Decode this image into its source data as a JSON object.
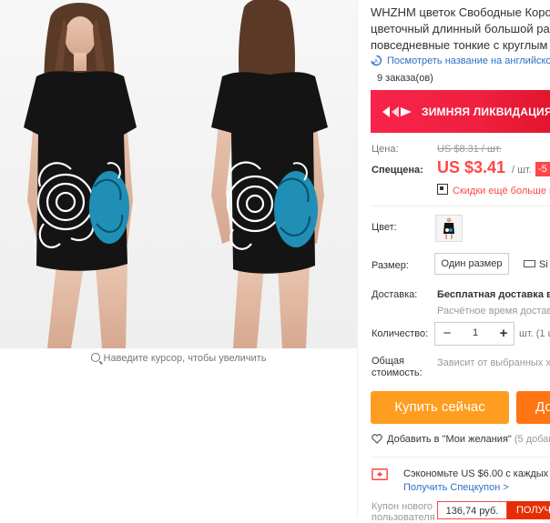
{
  "product": {
    "title_lines": [
      "WHZHM цветок Свободные Коро",
      "цветочный длинный большой ра",
      "повседневные тонкие с круглым"
    ],
    "translate_link": "Посмотреть название на английско",
    "orders": "9 заказа(ов)",
    "zoom_hint": "Наведите курсор, чтобы увеличить"
  },
  "banner": {
    "text": "ЗИМНЯЯ ЛИКВИДАЦИЯ"
  },
  "price": {
    "label": "Цена:",
    "old": "US $8.31 / шт.",
    "special_label": "Спеццена:",
    "special": "US $3.41",
    "unit": "/ шт.",
    "discount": "-5",
    "more_discounts": "Скидки ещё больше в"
  },
  "options": {
    "color_label": "Цвет:",
    "size_label": "Размер:",
    "size_value": "Один размер",
    "size_chart": "Si"
  },
  "shipping": {
    "label": "Доставка:",
    "value": "Бесплатная доставка в R",
    "time": "Расчётное время доставк"
  },
  "quantity": {
    "label": "Количество:",
    "minus": "−",
    "value": "1",
    "plus": "+",
    "unit": "шт. (1 шт."
  },
  "total": {
    "label_line1": "Общая",
    "label_line2": "стоимость:",
    "value": "Зависит от выбранных хар"
  },
  "actions": {
    "buy_now": "Купить сейчас",
    "add_to_cart": "До",
    "wishlist": "Добавить в \"Мои желания\"",
    "wishlist_count": "(5 добав"
  },
  "coupon": {
    "text": "Сэкономьте US $6.00 с каждых US",
    "link": "Получить Спецкупон >"
  },
  "new_user": {
    "label_line1": "Купон нового",
    "label_line2": "пользователя",
    "amount": "136,74 руб.",
    "button": "ПОЛУЧ"
  },
  "colors": {
    "accent_red": "#ff4747",
    "buy_orange": "#ff9d20",
    "cart_orange": "#ff7513",
    "link_blue": "#2e6fc8",
    "dress_black": "#141414",
    "flower_teal": "#1f8fb5"
  },
  "icons": [
    "translate-icon",
    "magnifier-icon",
    "qr-icon",
    "ruler-icon",
    "heart-icon",
    "coupon-icon"
  ]
}
